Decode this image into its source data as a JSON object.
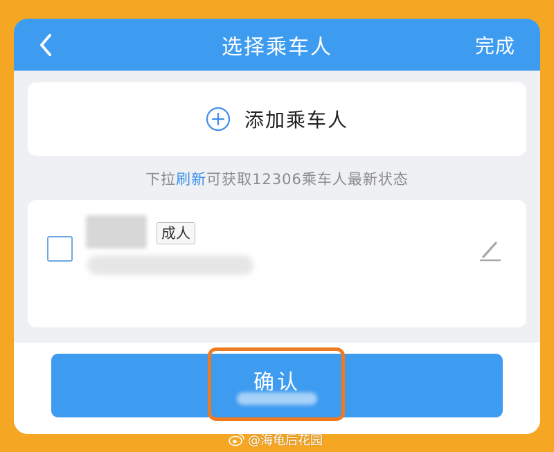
{
  "header": {
    "back_icon": "chevron-left-icon",
    "title": "选择乘车人",
    "done_label": "完成",
    "background": "#3D9BF0"
  },
  "add_card": {
    "icon": "plus-circle-icon",
    "label": "添加乘车人"
  },
  "hint": {
    "prefix": "下拉",
    "link": "刷新",
    "suffix": "可获取12306乘车人最新状态"
  },
  "passenger": {
    "checked": false,
    "type_badge": "成人",
    "edit_icon": "pencil-icon"
  },
  "footer": {
    "confirm_label": "确认",
    "highlight_color": "#F07A20"
  },
  "watermark": {
    "text": "@海龟后花园",
    "icon": "weibo-logo-icon"
  },
  "colors": {
    "frame": "#F5A623",
    "accent": "#3D9BF0",
    "link": "#3D8FE8"
  }
}
